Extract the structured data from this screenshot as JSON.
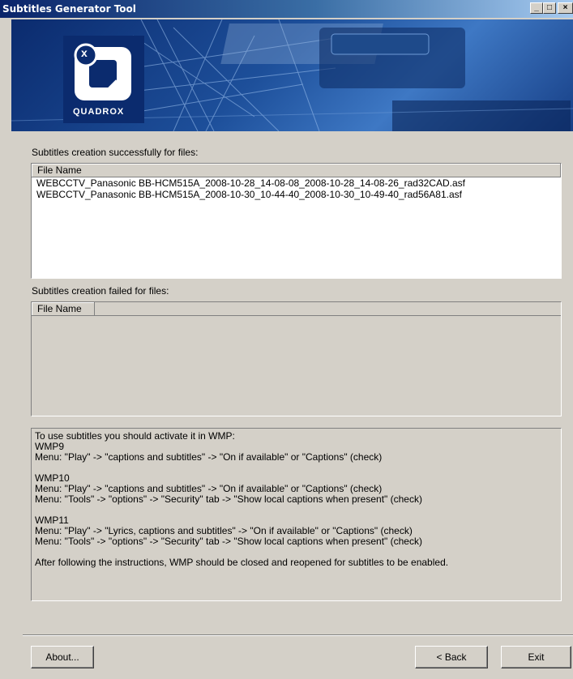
{
  "window": {
    "title": "Subtitles Generator Tool",
    "minimize_label": "_",
    "restore_label": "□",
    "close_label": "×"
  },
  "banner": {
    "logo_text": "QUADROX",
    "logo_glyph": "x",
    "colors": {
      "banner_dark": "#0b2b6e",
      "banner_light": "#3e78c4"
    }
  },
  "success": {
    "label": "Subtitles creation successfully for files:",
    "column_header": "File Name",
    "files": [
      "WEBCCTV_Panasonic BB-HCM515A_2008-10-28_14-08-08_2008-10-28_14-08-26_rad32CAD.asf",
      "WEBCCTV_Panasonic BB-HCM515A_2008-10-30_10-44-40_2008-10-30_10-49-40_rad56A81.asf"
    ]
  },
  "failed": {
    "label": "Subtitles creation failed for files:",
    "column_header": "File Name",
    "files": []
  },
  "instructions": {
    "intro": "To use subtitles you should activate it in WMP:",
    "wmp9_title": "WMP9",
    "wmp9_line1": " Menu: \"Play\" -> \"captions and subtitles\" -> \"On if available\" or \"Captions\" (check)",
    "wmp10_title": "WMP10",
    "wmp10_line1": " Menu: \"Play\" -> \"captions and subtitles\" -> \"On if available\" or \"Captions\" (check)",
    "wmp10_line2": " Menu: \"Tools\" -> \"options\" -> \"Security\" tab -> \"Show local captions when present\" (check)",
    "wmp11_title": "WMP11",
    "wmp11_line1": " Menu: \"Play\" -> \"Lyrics, captions and subtitles\" -> \"On if available\" or \"Captions\" (check)",
    "wmp11_line2": " Menu: \"Tools\" -> \"options\" -> \"Security\" tab -> \"Show local captions when present\" (check)",
    "closing": " After following the instructions, WMP should be closed and reopened for subtitles to be enabled."
  },
  "buttons": {
    "about": "About...",
    "back": "< Back",
    "exit": "Exit"
  }
}
